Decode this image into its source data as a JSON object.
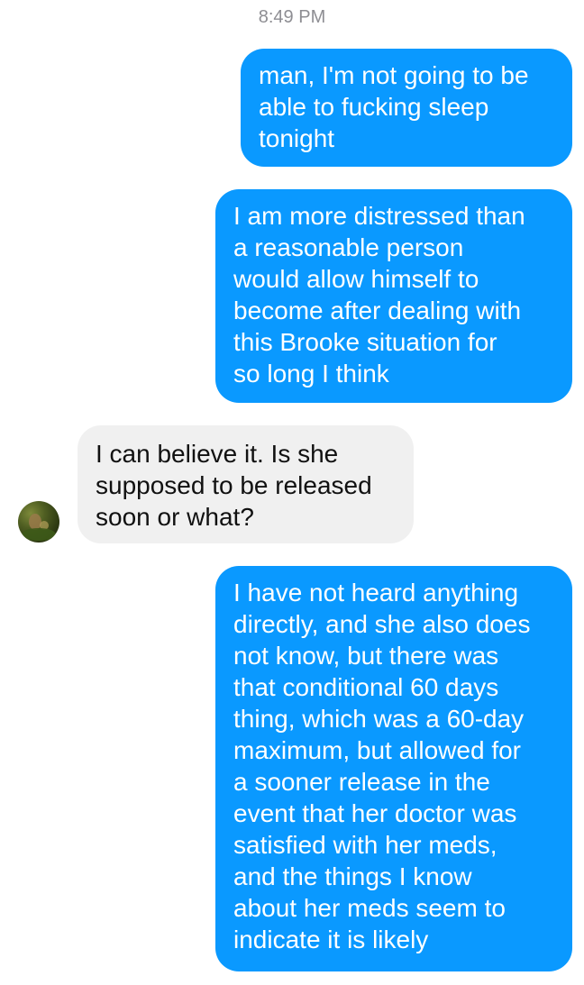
{
  "conversation": {
    "timestamp": "8:49 PM",
    "messages": [
      {
        "direction": "outgoing",
        "text": "man, I'm not going to be\nable to fucking sleep\ntonight"
      },
      {
        "direction": "outgoing",
        "text": "I am more distressed than\na reasonable person\nwould allow himself to\nbecome after dealing with\nthis Brooke situation for\nso long I think"
      },
      {
        "direction": "incoming",
        "text": "I can believe it. Is she\nsupposed to be released\nsoon or what?"
      },
      {
        "direction": "outgoing",
        "text": "I have not heard anything\ndirectly, and she also does\nnot know, but there was\nthat conditional 60 days\nthing, which was a 60-day\nmaximum, but allowed for\na sooner release in the\nevent that her doctor was\nsatisfied with her meds,\nand the things I know\nabout her meds seem to\nindicate it is likely"
      }
    ]
  },
  "colors": {
    "outgoing_bubble": "#0a99ff",
    "incoming_bubble": "#f0f0f0",
    "timestamp_text": "#8e8e93"
  },
  "icons": {
    "contact_avatar": "contact-avatar-photo"
  }
}
